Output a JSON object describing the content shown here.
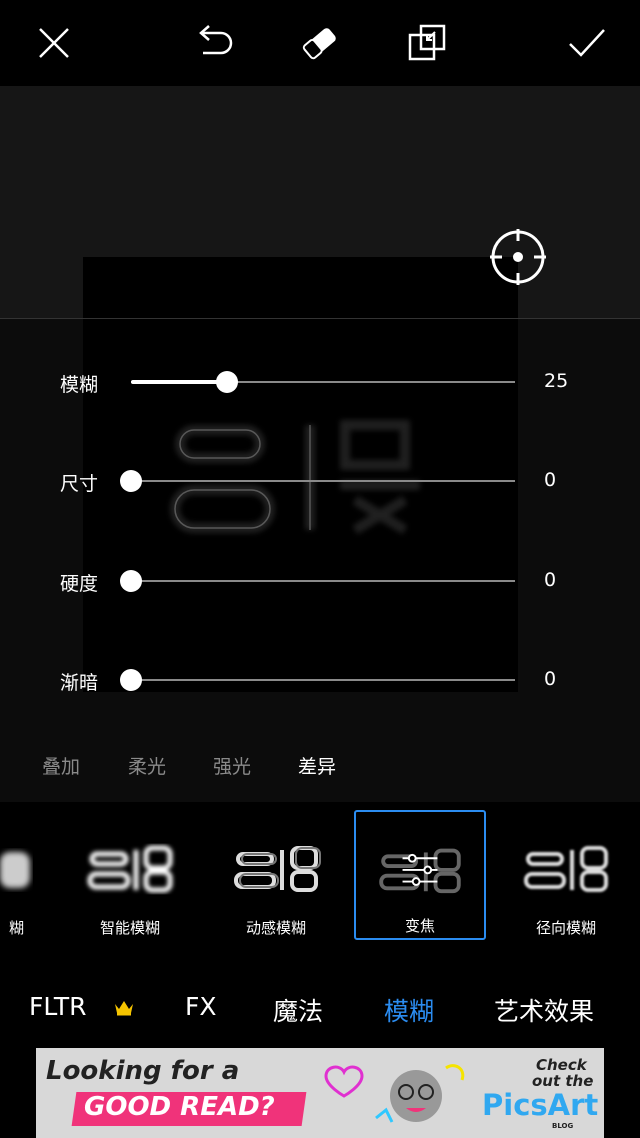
{
  "toolbar": {
    "close_icon": "close-icon",
    "undo_icon": "undo-icon",
    "eraser_icon": "eraser-icon",
    "compare_icon": "compare-icon",
    "apply_icon": "checkmark-icon"
  },
  "canvas": {
    "focus_icon": "crosshair-target-icon",
    "preview_text": "二傻"
  },
  "sliders": [
    {
      "label": "模糊",
      "value": "25",
      "fraction": 0.25
    },
    {
      "label": "尺寸",
      "value": "0",
      "fraction": 0
    },
    {
      "label": "硬度",
      "value": "0",
      "fraction": 0
    },
    {
      "label": "渐暗",
      "value": "0",
      "fraction": 0
    }
  ],
  "blend_modes": {
    "items": [
      "叠加",
      "柔光",
      "强光",
      "差异"
    ],
    "selected": "差异"
  },
  "effects": {
    "items": [
      {
        "label": "糊"
      },
      {
        "label": "智能模糊"
      },
      {
        "label": "动感模糊"
      },
      {
        "label": "变焦"
      },
      {
        "label": "径向模糊"
      }
    ],
    "selected": "变焦"
  },
  "categories": {
    "items": [
      "FLTR",
      "FX",
      "魔法",
      "模糊",
      "艺术效果"
    ],
    "active": "模糊",
    "premium_icon": "crown-icon"
  },
  "ad": {
    "line1": "Looking for a",
    "line2": "GOOD READ?",
    "cta_line1": "Check",
    "cta_line2": "out the",
    "brand": "PicsArt",
    "brand_sub": "BLOG"
  },
  "colors": {
    "accent": "#2b8cf0",
    "ad_pink": "#f0337a",
    "crown": "#f5c400"
  }
}
